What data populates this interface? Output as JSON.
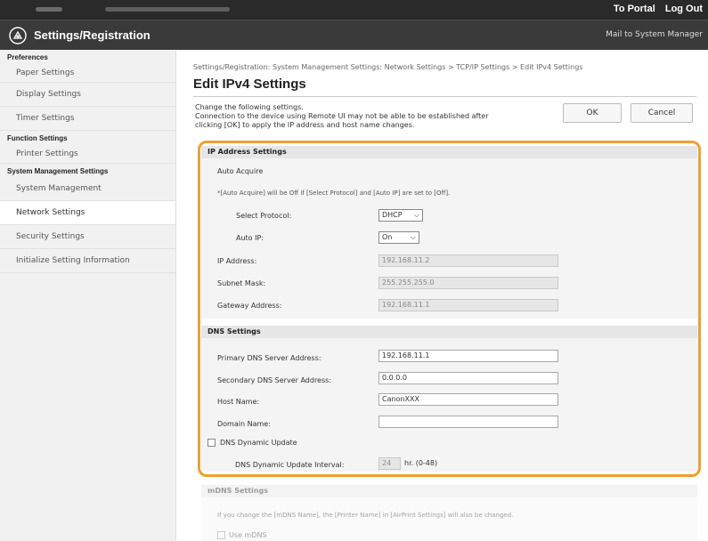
{
  "topbar": {
    "portal": "To Portal",
    "logout": "Log Out"
  },
  "header": {
    "title": "Settings/Registration",
    "mail": "Mail to System Manager"
  },
  "sidebar": {
    "preferences_h": "Preferences",
    "paper": "Paper Settings",
    "display": "Display Settings",
    "timer": "Timer Settings",
    "function_h": "Function Settings",
    "printer": "Printer Settings",
    "sysmgmt_h": "System Management Settings",
    "sysmgmt": "System Management",
    "network": "Network Settings",
    "security": "Security Settings",
    "init": "Initialize Setting Information"
  },
  "main": {
    "breadcrumb": "Settings/Registration: System Management Settings: Network Settings > TCP/IP Settings > Edit IPv4 Settings",
    "title": "Edit IPv4 Settings",
    "desc1": "Change the following settings.",
    "desc2": "Connection to the device using Remote UI may not be able to be established after",
    "desc3": "clicking [OK] to apply the IP address and host name changes.",
    "ok": "OK",
    "cancel": "Cancel"
  },
  "ip": {
    "header": "IP Address Settings",
    "auto_acquire": "Auto Acquire",
    "note": "*[Auto Acquire] will be Off if [Select Protocol] and [Auto IP] are set to [Off].",
    "protocol_label": "Select Protocol:",
    "protocol_value": "DHCP",
    "autoip_label": "Auto IP:",
    "autoip_value": "On",
    "address_label": "IP Address:",
    "address_value": "192.168.11.2",
    "mask_label": "Subnet Mask:",
    "mask_value": "255.255.255.0",
    "gateway_label": "Gateway Address:",
    "gateway_value": "192.168.11.1"
  },
  "dns": {
    "header": "DNS Settings",
    "primary_label": "Primary DNS Server Address:",
    "primary_value": "192.168.11.1",
    "secondary_label": "Secondary DNS Server Address:",
    "secondary_value": "0.0.0.0",
    "host_label": "Host Name:",
    "host_value": "CanonXXX",
    "domain_label": "Domain Name:",
    "domain_value": "",
    "dynamic_label": "DNS Dynamic Update",
    "interval_label": "DNS Dynamic Update Interval:",
    "interval_value": "24",
    "interval_unit": "hr. (0-48)"
  },
  "mdns": {
    "header": "mDNS Settings",
    "note": "If you change the [mDNS Name], the [Printer Name] in [AirPrint Settings] will also be changed.",
    "use_label": "Use mDNS"
  },
  "colors": {
    "accent": "#f0a030",
    "topbar": "#2a2a2a",
    "header": "#3a3a3a"
  }
}
